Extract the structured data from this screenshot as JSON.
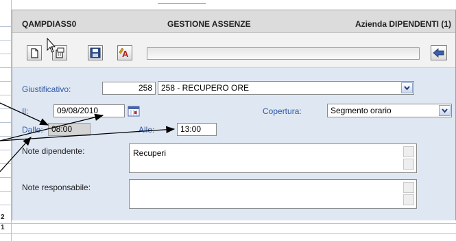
{
  "window": {
    "program_code": "QAMPDIASS0",
    "title": "GESTIONE ASSENZE",
    "company": "Azienda DIPENDENTI (1)"
  },
  "toolbar": {
    "icons": [
      "new-document-icon",
      "delete-document-icon",
      "save-icon",
      "spell-check-icon",
      "back-arrow-icon"
    ],
    "status_text": ""
  },
  "form": {
    "giustificativo": {
      "label": "Giustificativo:",
      "code": "258",
      "selected": "258 - RECUPERO ORE"
    },
    "date": {
      "label": "Il:",
      "value": "09/08/2010"
    },
    "copertura": {
      "label": "Copertura:",
      "selected": "Segmento orario"
    },
    "dalle": {
      "label": "Dalle:",
      "value": "08:00"
    },
    "alle": {
      "label": "Alle:",
      "value": "13:00"
    },
    "note_dipendente": {
      "label": "Note dipendente:",
      "value": "Recuperi"
    },
    "note_responsabile": {
      "label": "Note responsabile:",
      "value": ""
    }
  },
  "sheet": {
    "row_numbers": [
      "2",
      "1"
    ]
  },
  "colors": {
    "form_bg": "#dfe7f3",
    "label_blue": "#2f5aa6",
    "titlebar_bg": "#dcdcdc"
  }
}
